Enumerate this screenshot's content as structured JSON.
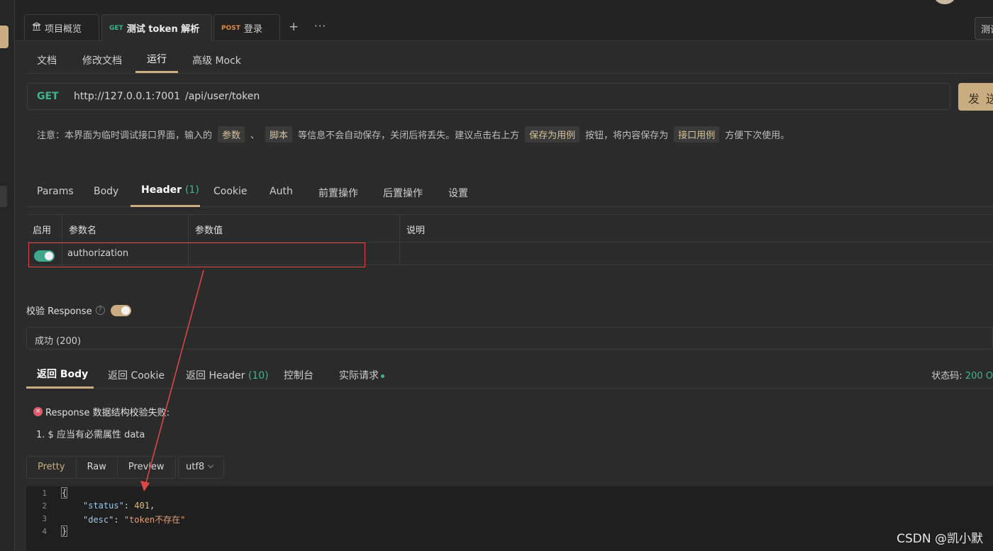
{
  "tabs": [
    {
      "label": "项目概览",
      "icon": "bank-icon"
    },
    {
      "method": "GET",
      "label": "测试 token 解析",
      "unsaved": true
    },
    {
      "method": "POST",
      "label": "登录"
    }
  ],
  "tab_actions": {
    "add": "+",
    "more": "···"
  },
  "top_right_label": "测试",
  "subnav": [
    "文档",
    "修改文档",
    "运行",
    "高级 Mock"
  ],
  "subnav_active": "运行",
  "request": {
    "method": "GET",
    "base_url": "http://127.0.0.1:7001",
    "path": "/api/user/token",
    "send_label": "发 送"
  },
  "notice": {
    "t1": "注意：本界面为临时调试接口界面，输入的",
    "chip1": "参数",
    "sep": "、",
    "chip2": "脚本",
    "t2": "等信息不会自动保存，关闭后将丢失。建议点击右上方",
    "chip3": "保存为用例",
    "t3": "按钮，将内容保存为",
    "chip4": "接口用例",
    "t4": "方便下次使用。"
  },
  "req_tabs": [
    {
      "label": "Params"
    },
    {
      "label": "Body"
    },
    {
      "label": "Header",
      "count": "(1)"
    },
    {
      "label": "Cookie"
    },
    {
      "label": "Auth"
    },
    {
      "label": "前置操作"
    },
    {
      "label": "后置操作"
    },
    {
      "label": "设置"
    }
  ],
  "header_table": {
    "columns": [
      "启用",
      "参数名",
      "参数值",
      "说明"
    ],
    "rows": [
      {
        "enabled": true,
        "name": "authorization",
        "value": "",
        "desc": ""
      }
    ]
  },
  "validate": {
    "label": "校验 Response",
    "help": "?",
    "enabled": true
  },
  "response_status_select": "成功 (200)",
  "resp_tabs": [
    {
      "label": "返回 Body"
    },
    {
      "label": "返回 Cookie"
    },
    {
      "label": "返回 Header",
      "count": "(10)"
    },
    {
      "label": "控制台"
    },
    {
      "label": "实际请求",
      "dot": true
    }
  ],
  "status_code": {
    "label": "状态码:",
    "value": "200 O"
  },
  "validation_error": {
    "icon": "×",
    "title": "Response 数据结构校验失败:",
    "items": [
      "1. $ 应当有必需属性 data"
    ]
  },
  "view_modes": [
    "Pretty",
    "Raw",
    "Preview"
  ],
  "view_active": "Pretty",
  "encoding": "utf8",
  "code": {
    "line_numbers": [
      "1",
      "2",
      "3",
      "4"
    ],
    "open_brace": "{",
    "status_key": "\"status\"",
    "status_val": "401",
    "desc_key": "\"desc\"",
    "desc_val": "\"token不存在\"",
    "close_brace": "}",
    "colon": ": ",
    "comma": ","
  },
  "watermark": "CSDN @凯小默",
  "colors": {
    "accent": "#c9ad80",
    "get": "#3fb58a",
    "post": "#e08a3c",
    "highlight": "#e04848"
  }
}
